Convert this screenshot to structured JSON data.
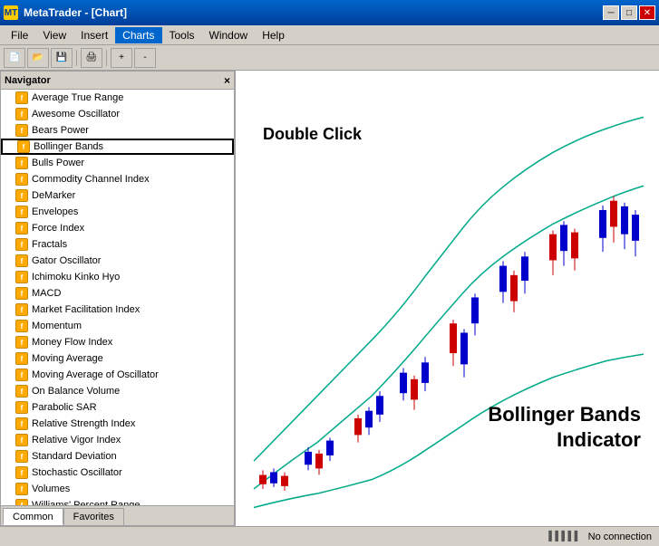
{
  "window": {
    "title": "MetaTrader - [Chart]",
    "app_icon": "MT"
  },
  "title_buttons": {
    "minimize": "─",
    "maximize": "□",
    "close": "✕"
  },
  "menu": {
    "items": [
      "File",
      "View",
      "Insert",
      "Charts",
      "Tools",
      "Window",
      "Help"
    ]
  },
  "navigator": {
    "title": "Navigator",
    "close": "×",
    "indicators": [
      "Average True Range",
      "Awesome Oscillator",
      "Bears Power",
      "Bollinger Bands",
      "Bulls Power",
      "Commodity Channel Index",
      "DeMarker",
      "Envelopes",
      "Force Index",
      "Fractals",
      "Gator Oscillator",
      "Ichimoku Kinko Hyo",
      "MACD",
      "Market Facilitation Index",
      "Momentum",
      "Money Flow Index",
      "Moving Average",
      "Moving Average of Oscillator",
      "On Balance Volume",
      "Parabolic SAR",
      "Relative Strength Index",
      "Relative Vigor Index",
      "Standard Deviation",
      "Stochastic Oscillator",
      "Volumes",
      "Williams' Percent Range"
    ],
    "selected_index": 3,
    "tabs": [
      "Common",
      "Favorites"
    ]
  },
  "chart": {
    "double_click_label": "Double Click",
    "bb_label_line1": "Bollinger Bands",
    "bb_label_line2": "Indicator"
  },
  "status_bar": {
    "icon": "▌▌▌▌▌",
    "text": "No connection"
  }
}
